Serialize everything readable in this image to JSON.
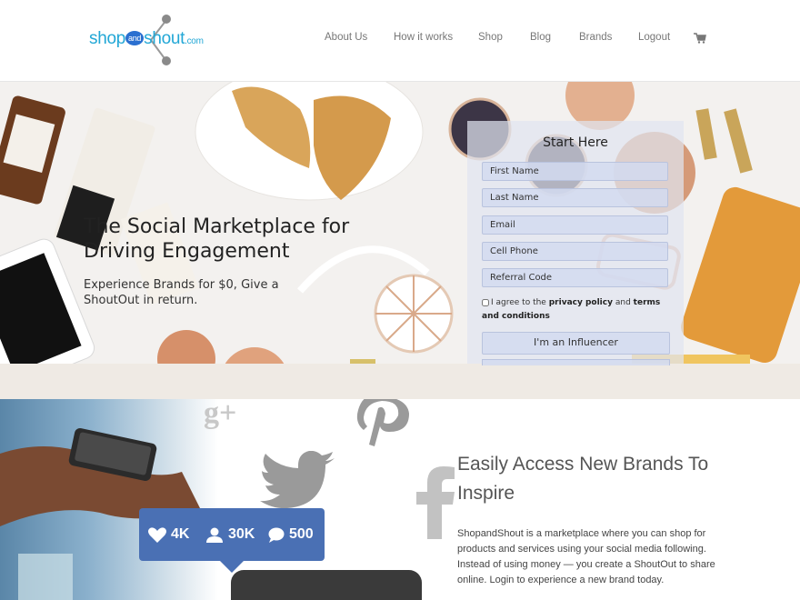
{
  "header": {
    "logo": {
      "part1": "shop",
      "part2": "and",
      "part3": "shout",
      "part4": ".com"
    },
    "nav": [
      {
        "label": "About Us",
        "name": "nav-about-us"
      },
      {
        "label": "How it works",
        "name": "nav-how-it-works"
      },
      {
        "label": "Shop",
        "name": "nav-shop"
      },
      {
        "label": "Blog",
        "name": "nav-blog"
      },
      {
        "label": "Brands",
        "name": "nav-brands"
      },
      {
        "label": "Logout",
        "name": "nav-logout"
      }
    ],
    "cart_icon": "shopping-cart-icon"
  },
  "hero": {
    "title": "The Social Marketplace for Driving Engagement",
    "subtitle": "Experience Brands for $0, Give a ShoutOut in return.",
    "form": {
      "title": "Start Here",
      "first_name_placeholder": "First Name",
      "last_name_placeholder": "Last Name",
      "email_placeholder": "Email",
      "cell_phone_placeholder": "Cell Phone",
      "referral_code_placeholder": "Referral Code",
      "agree_prefix": "I agree to the",
      "privacy_policy": "privacy policy",
      "and": "and",
      "terms": "terms and conditions",
      "influencer_button": "I'm an Influencer"
    }
  },
  "feature": {
    "heading": "Easily Access New Brands To Inspire",
    "body": "ShopandShout is a marketplace where you can shop for products and services using your social media following. Instead of using money — you create a ShoutOut to share online. Login to experience a new brand today.",
    "stats": {
      "likes": "4K",
      "followers": "30K",
      "comments": "500"
    },
    "icons": [
      "google-plus-icon",
      "pinterest-icon",
      "twitter-icon",
      "facebook-icon"
    ]
  },
  "colors": {
    "brand_blue": "#22a7d6",
    "stats_blue": "#4a70b4",
    "nav_gray": "#777777"
  }
}
